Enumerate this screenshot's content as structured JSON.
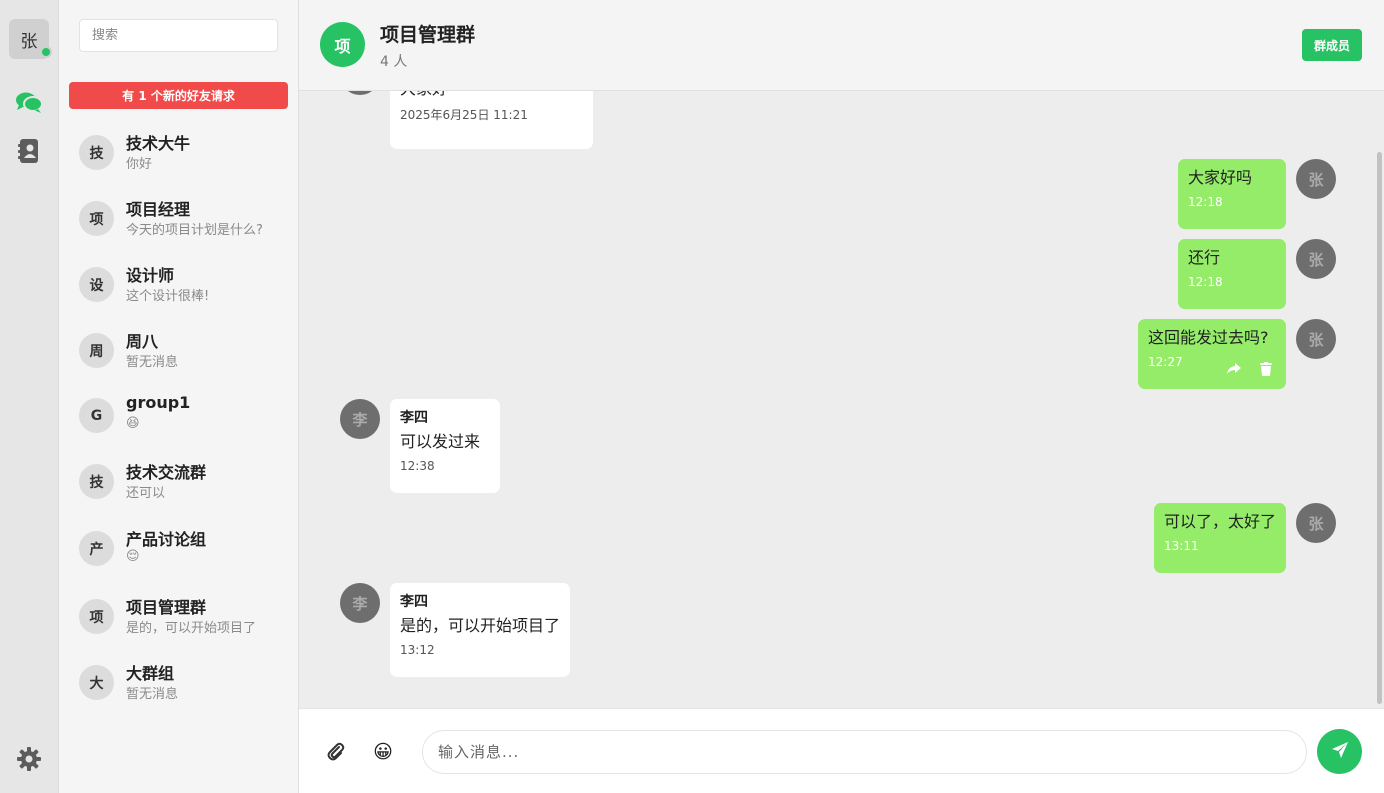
{
  "user": {
    "avatar_text": "张"
  },
  "search": {
    "placeholder": "搜索"
  },
  "friend_request_banner": "有 1 个新的好友请求",
  "conversations": [
    {
      "avatar": "技",
      "name": "技术大牛",
      "preview": "你好"
    },
    {
      "avatar": "项",
      "name": "项目经理",
      "preview": "今天的项目计划是什么?"
    },
    {
      "avatar": "设",
      "name": "设计师",
      "preview": "这个设计很棒!"
    },
    {
      "avatar": "周",
      "name": "周八",
      "preview": "暂无消息"
    },
    {
      "avatar": "G",
      "name": "group1",
      "preview": "😆"
    },
    {
      "avatar": "技",
      "name": "技术交流群",
      "preview": "还可以"
    },
    {
      "avatar": "产",
      "name": "产品讨论组",
      "preview": "😌"
    },
    {
      "avatar": "项",
      "name": "项目管理群",
      "preview": "是的，可以开始项目了"
    },
    {
      "avatar": "大",
      "name": "大群组",
      "preview": "暂无消息"
    }
  ],
  "chat": {
    "avatar": "项",
    "title": "项目管理群",
    "member_count": "4 人",
    "members_button": "群成员",
    "messages": [
      {
        "direction": "in",
        "text": "大家好",
        "time": "2025年6月25日 11:21"
      },
      {
        "direction": "out",
        "avatar": "张",
        "text": "大家好吗",
        "time": "12:18"
      },
      {
        "direction": "out",
        "avatar": "张",
        "text": "还行",
        "time": "12:18"
      },
      {
        "direction": "out",
        "avatar": "张",
        "text": "这回能发过去吗?",
        "time": "12:27"
      },
      {
        "direction": "in",
        "avatar": "李",
        "sender": "李四",
        "text": "可以发过来",
        "time": "12:38"
      },
      {
        "direction": "out",
        "avatar": "张",
        "text": "可以了，太好了",
        "time": "13:11"
      },
      {
        "direction": "in",
        "avatar": "李",
        "sender": "李四",
        "text": "是的，可以开始项目了",
        "time": "13:12"
      }
    ]
  },
  "composer": {
    "placeholder": "输入消息..."
  },
  "icons": {
    "chats": "chat-bubbles-icon",
    "contacts": "contacts-book-icon",
    "settings": "gear-icon",
    "attach": "paperclip-icon",
    "emoji": "emoji-icon",
    "send": "paper-plane-icon",
    "forward": "share-icon",
    "delete": "trash-icon"
  },
  "colors": {
    "accent": "#27c264",
    "outgoing_bubble": "#95ec69",
    "alert": "#f04a4a"
  }
}
